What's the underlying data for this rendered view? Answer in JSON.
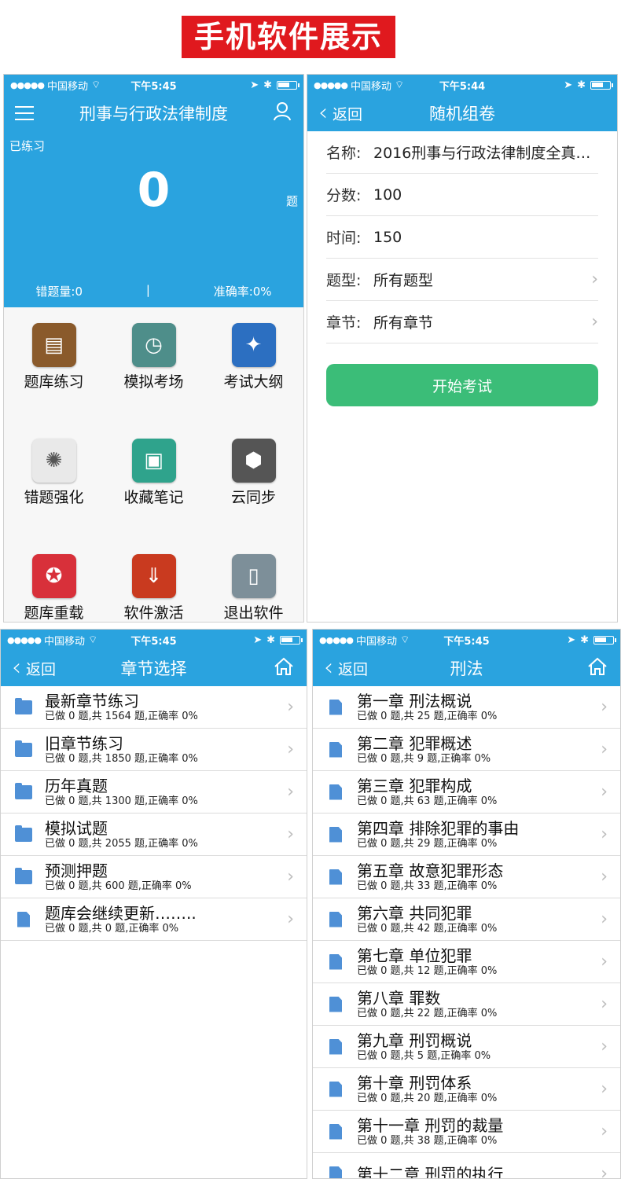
{
  "banner": "手机软件展示",
  "status": {
    "carrier": "中国移动",
    "time_a": "下午5:45",
    "time_b": "下午5:44"
  },
  "p1": {
    "title": "刑事与行政法律制度",
    "practiced_label": "已练习",
    "practiced_count": "0",
    "unit": "题",
    "wrong": "错题量:0",
    "divider": "|",
    "accuracy": "准确率:0%",
    "tiles": [
      {
        "label": "题库练习",
        "icon": "book-icon",
        "color": "#8a5a2b"
      },
      {
        "label": "模拟考场",
        "icon": "clock-icon",
        "color": "#4e8e8a"
      },
      {
        "label": "考试大纲",
        "icon": "compass-icon",
        "color": "#2c6fc1"
      },
      {
        "label": "错题强化",
        "icon": "sun-icon",
        "color": "#e9e9e9"
      },
      {
        "label": "收藏笔记",
        "icon": "note-icon",
        "color": "#2fa38c"
      },
      {
        "label": "云同步",
        "icon": "cubes-icon",
        "color": "#555555"
      },
      {
        "label": "题库重载",
        "icon": "reload-icon",
        "color": "#d8303a"
      },
      {
        "label": "软件激活",
        "icon": "activate-icon",
        "color": "#c93a1f"
      },
      {
        "label": "退出软件",
        "icon": "phone-icon",
        "color": "#7d8f99"
      }
    ]
  },
  "p2": {
    "back": "返回",
    "title": "随机组卷",
    "fields": [
      {
        "key": "名称:",
        "value": "2016刑事与行政法律制度全真…",
        "arrow": ""
      },
      {
        "key": "分数:",
        "value": "100",
        "arrow": ""
      },
      {
        "key": "时间:",
        "value": "150",
        "arrow": ""
      },
      {
        "key": "题型:",
        "value": "所有题型",
        "arrow": "›"
      },
      {
        "key": "章节:",
        "value": "所有章节",
        "arrow": "›"
      }
    ],
    "start": "开始考试"
  },
  "p3": {
    "back": "返回",
    "title": "章节选择",
    "items": [
      {
        "title": "最新章节练习",
        "sub": "已做 0 题,共 1564 题,正确率 0%",
        "icon": "folder-icon"
      },
      {
        "title": "旧章节练习",
        "sub": "已做 0 题,共 1850 题,正确率 0%",
        "icon": "folder-icon"
      },
      {
        "title": "历年真题",
        "sub": "已做 0 题,共 1300 题,正确率 0%",
        "icon": "folder-icon"
      },
      {
        "title": "模拟试题",
        "sub": "已做 0 题,共 2055 题,正确率 0%",
        "icon": "folder-icon"
      },
      {
        "title": "预测押题",
        "sub": "已做 0 题,共 600 题,正确率 0%",
        "icon": "folder-icon"
      },
      {
        "title": "题库会继续更新……..",
        "sub": "已做 0 题,共 0 题,正确率 0%",
        "icon": "doc-icon"
      }
    ]
  },
  "p4": {
    "back": "返回",
    "title": "刑法",
    "items": [
      {
        "title": "第一章 刑法概说",
        "sub": "已做 0 题,共 25 题,正确率 0%"
      },
      {
        "title": "第二章 犯罪概述",
        "sub": "已做 0 题,共 9 题,正确率 0%"
      },
      {
        "title": "第三章 犯罪构成",
        "sub": "已做 0 题,共 63 题,正确率 0%"
      },
      {
        "title": "第四章 排除犯罪的事由",
        "sub": "已做 0 题,共 29 题,正确率 0%"
      },
      {
        "title": "第五章 故意犯罪形态",
        "sub": "已做 0 题,共 33 题,正确率 0%"
      },
      {
        "title": "第六章 共同犯罪",
        "sub": "已做 0 题,共 42 题,正确率 0%"
      },
      {
        "title": "第七章 单位犯罪",
        "sub": "已做 0 题,共 12 题,正确率 0%"
      },
      {
        "title": "第八章 罪数",
        "sub": "已做 0 题,共 22 题,正确率 0%"
      },
      {
        "title": "第九章 刑罚概说",
        "sub": "已做 0 题,共 5 题,正确率 0%"
      },
      {
        "title": "第十章 刑罚体系",
        "sub": "已做 0 题,共 20 题,正确率 0%"
      },
      {
        "title": "第十一章 刑罚的裁量",
        "sub": "已做 0 题,共 38 题,正确率 0%"
      },
      {
        "title": "第十二章 刑罚的执行",
        "sub": ""
      }
    ]
  },
  "colors": {
    "nav_blue": "#2aa3df",
    "start_green": "#3bbd78",
    "banner_red": "#e0191e"
  }
}
